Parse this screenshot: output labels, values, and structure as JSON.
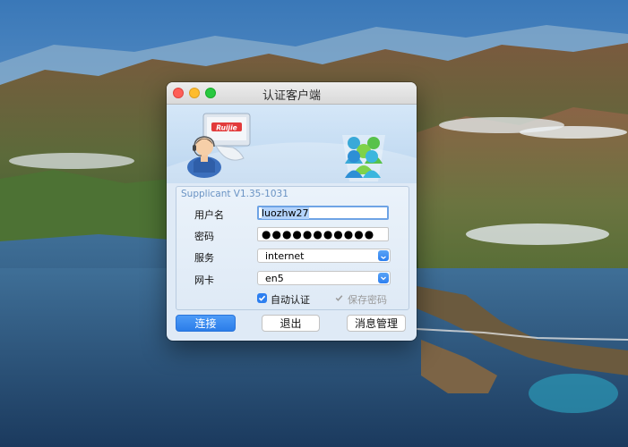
{
  "window": {
    "title": "认证客户端"
  },
  "banner": {
    "logo_text": "Ruijie"
  },
  "form": {
    "version": "Supplicant V1.35-1031",
    "username_label": "用户名",
    "username_value": "luozhw27",
    "password_label": "密码",
    "password_value": "●●●●●●●●●●●",
    "service_label": "服务",
    "service_value": "internet",
    "nic_label": "网卡",
    "nic_value": "en5",
    "auto_auth_label": "自动认证",
    "auto_auth_checked": true,
    "save_password_label": "保存密码",
    "save_password_checked": true
  },
  "buttons": {
    "connect": "连接",
    "exit": "退出",
    "messages": "消息管理"
  },
  "colors": {
    "accent": "#2d7ff0",
    "close": "#fe5f57",
    "minimize": "#febc2e",
    "maximize": "#28c840",
    "version_text": "#6a93c4"
  }
}
